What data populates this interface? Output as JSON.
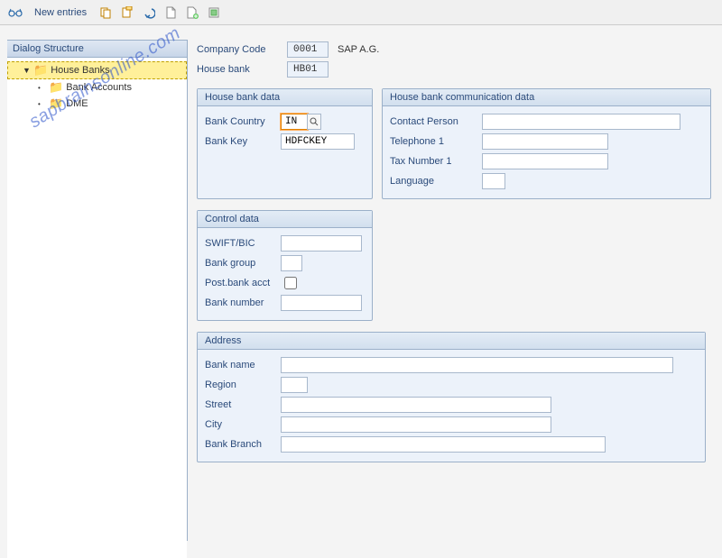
{
  "toolbar": {
    "new_entries": "New entries"
  },
  "sidebar": {
    "title": "Dialog Structure",
    "items": [
      {
        "label": "House Banks"
      },
      {
        "label": "Bank Accounts"
      },
      {
        "label": "DME"
      }
    ]
  },
  "header": {
    "company_code_label": "Company Code",
    "company_code_value": "0001",
    "company_code_desc": "SAP A.G.",
    "house_bank_label": "House bank",
    "house_bank_value": "HB01"
  },
  "groups": {
    "house_bank_data": {
      "title": "House bank data",
      "bank_country_label": "Bank Country",
      "bank_country_value": "IN",
      "bank_key_label": "Bank Key",
      "bank_key_value": "HDFCKEY"
    },
    "house_bank_comm": {
      "title": "House bank communication data",
      "contact_person_label": "Contact Person",
      "contact_person_value": "",
      "telephone1_label": "Telephone 1",
      "telephone1_value": "",
      "tax_number1_label": "Tax Number 1",
      "tax_number1_value": "",
      "language_label": "Language",
      "language_value": ""
    },
    "control_data": {
      "title": "Control data",
      "swift_label": "SWIFT/BIC",
      "swift_value": "",
      "bank_group_label": "Bank group",
      "bank_group_value": "",
      "post_bank_acct_label": "Post.bank acct",
      "bank_number_label": "Bank number",
      "bank_number_value": ""
    },
    "address": {
      "title": "Address",
      "bank_name_label": "Bank name",
      "bank_name_value": "",
      "region_label": "Region",
      "region_value": "",
      "street_label": "Street",
      "street_value": "",
      "city_label": "City",
      "city_value": "",
      "bank_branch_label": "Bank Branch",
      "bank_branch_value": ""
    }
  },
  "watermark": "sapbrainsonline.com"
}
